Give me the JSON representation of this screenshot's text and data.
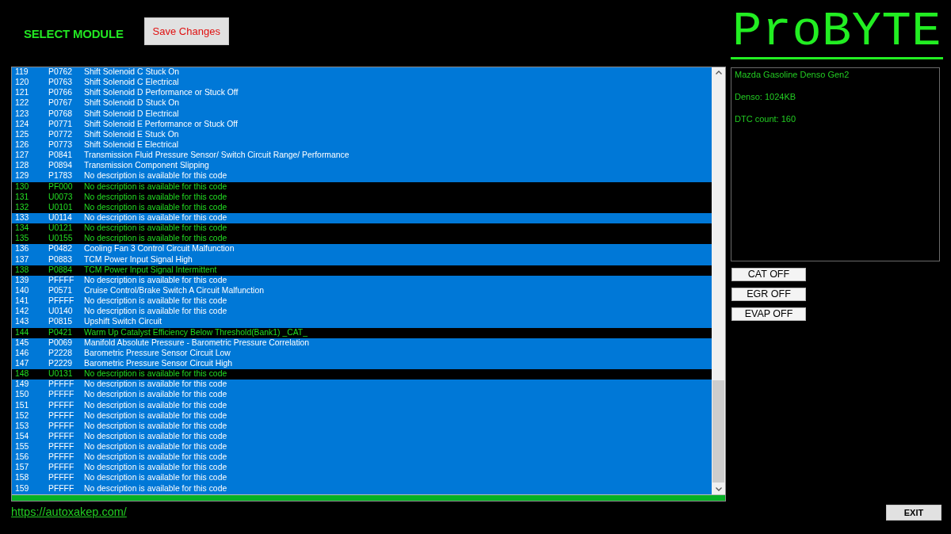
{
  "header": {
    "title": "SELECT MODULE",
    "save_button": "Save Changes"
  },
  "logo": {
    "text": "ProBYTE"
  },
  "dtc_list": {
    "rows": [
      {
        "number": "119",
        "code": "P0762",
        "description": "Shift Solenoid C Stuck On",
        "selected": true
      },
      {
        "number": "120",
        "code": "P0763",
        "description": "Shift Solenoid C Electrical",
        "selected": true
      },
      {
        "number": "121",
        "code": "P0766",
        "description": "Shift Solenoid D Performance or Stuck Off",
        "selected": true
      },
      {
        "number": "122",
        "code": "P0767",
        "description": "Shift Solenoid D Stuck On",
        "selected": true
      },
      {
        "number": "123",
        "code": "P0768",
        "description": "Shift Solenoid D Electrical",
        "selected": true
      },
      {
        "number": "124",
        "code": "P0771",
        "description": "Shift Solenoid E Performance or Stuck Off",
        "selected": true
      },
      {
        "number": "125",
        "code": "P0772",
        "description": "Shift Solenoid E Stuck On",
        "selected": true
      },
      {
        "number": "126",
        "code": "P0773",
        "description": "Shift Solenoid E Electrical",
        "selected": true
      },
      {
        "number": "127",
        "code": "P0841",
        "description": "Transmission Fluid Pressure Sensor/ Switch Circuit Range/ Performance",
        "selected": true
      },
      {
        "number": "128",
        "code": "P0894",
        "description": "Transmission Component Slipping",
        "selected": true
      },
      {
        "number": "129",
        "code": "P1783",
        "description": "No description is available for this code",
        "selected": true
      },
      {
        "number": "130",
        "code": "PF000",
        "description": "No description is available for this code",
        "selected": false
      },
      {
        "number": "131",
        "code": "U0073",
        "description": "No description is available for this code",
        "selected": false
      },
      {
        "number": "132",
        "code": "U0101",
        "description": "No description is available for this code",
        "selected": false
      },
      {
        "number": "133",
        "code": "U0114",
        "description": "No description is available for this code",
        "selected": true
      },
      {
        "number": "134",
        "code": "U0121",
        "description": "No description is available for this code",
        "selected": false
      },
      {
        "number": "135",
        "code": "U0155",
        "description": "No description is available for this code",
        "selected": false
      },
      {
        "number": "136",
        "code": "P0482",
        "description": "Cooling Fan 3 Control Circuit Malfunction",
        "selected": true
      },
      {
        "number": "137",
        "code": "P0883",
        "description": "TCM Power Input Signal High",
        "selected": true
      },
      {
        "number": "138",
        "code": "P0884",
        "description": "TCM Power Input Signal Intermittent",
        "selected": false
      },
      {
        "number": "139",
        "code": "PFFFF",
        "description": "No description is available for this code",
        "selected": true
      },
      {
        "number": "140",
        "code": "P0571",
        "description": "Cruise Control/Brake Switch A Circuit Malfunction",
        "selected": true
      },
      {
        "number": "141",
        "code": "PFFFF",
        "description": "No description is available for this code",
        "selected": true
      },
      {
        "number": "142",
        "code": "U0140",
        "description": "No description is available for this code",
        "selected": true
      },
      {
        "number": "143",
        "code": "P0815",
        "description": "Upshift Switch Circuit",
        "selected": true
      },
      {
        "number": "144",
        "code": "P0421",
        "description": "Warm Up Catalyst Efficiency Below Threshold(Bank1) _CAT_",
        "selected": false
      },
      {
        "number": "145",
        "code": "P0069",
        "description": "Manifold Absolute Pressure - Barometric Pressure Correlation",
        "selected": true
      },
      {
        "number": "146",
        "code": "P2228",
        "description": "Barometric Pressure Sensor Circuit Low",
        "selected": true
      },
      {
        "number": "147",
        "code": "P2229",
        "description": "Barometric Pressure Sensor Circuit High",
        "selected": true
      },
      {
        "number": "148",
        "code": "U0131",
        "description": "No description is available for this code",
        "selected": false
      },
      {
        "number": "149",
        "code": "PFFFF",
        "description": "No description is available for this code",
        "selected": true
      },
      {
        "number": "150",
        "code": "PFFFF",
        "description": "No description is available for this code",
        "selected": true
      },
      {
        "number": "151",
        "code": "PFFFF",
        "description": "No description is available for this code",
        "selected": true
      },
      {
        "number": "152",
        "code": "PFFFF",
        "description": "No description is available for this code",
        "selected": true
      },
      {
        "number": "153",
        "code": "PFFFF",
        "description": "No description is available for this code",
        "selected": true
      },
      {
        "number": "154",
        "code": "PFFFF",
        "description": "No description is available for this code",
        "selected": true
      },
      {
        "number": "155",
        "code": "PFFFF",
        "description": "No description is available for this code",
        "selected": true
      },
      {
        "number": "156",
        "code": "PFFFF",
        "description": "No description is available for this code",
        "selected": true
      },
      {
        "number": "157",
        "code": "PFFFF",
        "description": "No description is available for this code",
        "selected": true
      },
      {
        "number": "158",
        "code": "PFFFF",
        "description": "No description is available for this code",
        "selected": true
      },
      {
        "number": "159",
        "code": "PFFFF",
        "description": "No description is available for this code",
        "selected": true
      }
    ],
    "progress": {
      "level": 1
    }
  },
  "info_panel": {
    "lines": [
      "Mazda Gasoline Denso Gen2",
      "Denso: 1024KB",
      "DTC count: 160"
    ]
  },
  "actions": [
    "CAT OFF",
    "EGR OFF",
    "EVAP OFF"
  ],
  "link": "https://autoxakep.com/",
  "exit_button": "EXIT"
}
